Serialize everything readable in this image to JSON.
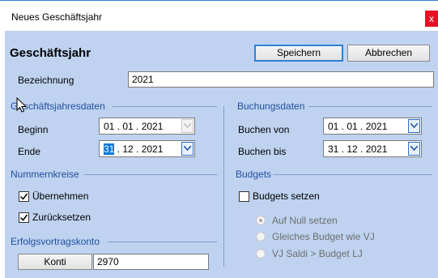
{
  "window": {
    "title": "Neues Geschäftsjahr",
    "close_glyph": "x"
  },
  "header": {
    "heading": "Geschäftsjahr",
    "save_label": "Speichern",
    "cancel_label": "Abbrechen"
  },
  "bezeichnung": {
    "label": "Bezeichnung",
    "value": "2021"
  },
  "gj_daten": {
    "title": "Geschäftsjahresdaten",
    "beginn_label": "Beginn",
    "beginn_value": "01 . 01 . 2021",
    "ende_label": "Ende",
    "ende_day": "31",
    "ende_rest": " . 12 . 2021"
  },
  "buchungsdaten": {
    "title": "Buchungsdaten",
    "von_label": "Buchen von",
    "von_value": "01 . 01 . 2021",
    "bis_label": "Buchen bis",
    "bis_value": "31 . 12 . 2021"
  },
  "nummernkreise": {
    "title": "Nummernkreise",
    "uebernehmen": {
      "label": "Übernehmen",
      "checked": true
    },
    "zuruecksetzen": {
      "label": "Zurücksetzen",
      "checked": true
    }
  },
  "budgets": {
    "title": "Budgets",
    "setzen": {
      "label": "Budgets setzen",
      "checked": false
    },
    "options": [
      "Auf Null setzen",
      "Gleiches Budget wie VJ",
      "VJ Saldi > Budget LJ"
    ],
    "selected_index": 0
  },
  "erfolgsvortrag": {
    "title": "Erfolgsvortragskonto",
    "button_label": "Konti",
    "value": "2970"
  },
  "colors": {
    "accent": "#0078d7",
    "group_title": "#1f4fa0",
    "dialog_bg": "#bfd3f0",
    "close_red": "#e81123"
  }
}
